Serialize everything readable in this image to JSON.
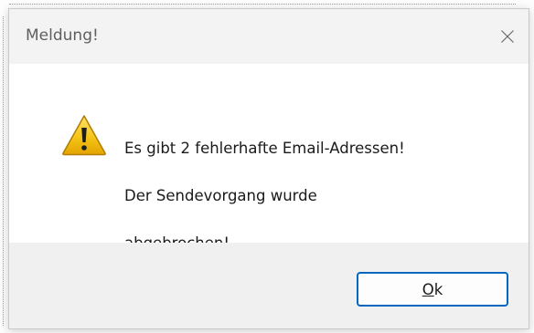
{
  "dialog": {
    "title": "Meldung!",
    "close_icon": "close-icon",
    "message_icon": "warning-icon",
    "message_lines": [
      "Es gibt 2 fehlerhafte Email-Adressen!",
      "Der Sendevorgang wurde",
      "abgebrochen!"
    ],
    "ok_button": {
      "mnemonic": "O",
      "rest": "k"
    }
  },
  "colors": {
    "accent": "#0067c0",
    "title_bar": "#f3f3f3",
    "footer": "#f0f0f0",
    "warning_fill": "#f5c518"
  }
}
